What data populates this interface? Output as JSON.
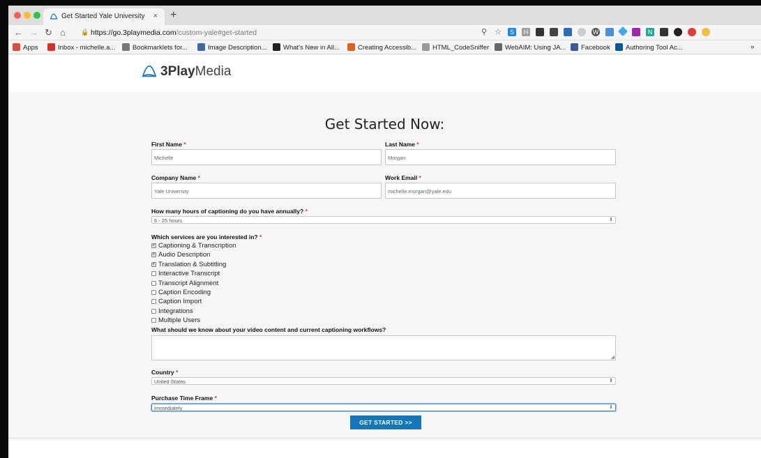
{
  "browser": {
    "tab_title": "Get Started Yale University",
    "tab_close": "×",
    "new_tab": "+",
    "url_host": "https://go.3playmedia.com",
    "url_path": "/custom-yale#get-started",
    "bookmarks": [
      {
        "label": "Apps",
        "icon": "apps-grid-icon",
        "color": "#e24b3b"
      },
      {
        "label": "Inbox - michelle.a...",
        "icon": "gmail-icon",
        "color": "#d93025"
      },
      {
        "label": "Bookmarklets for...",
        "icon": "folder-icon",
        "color": "#777777"
      },
      {
        "label": "Image Description...",
        "icon": "image-icon",
        "color": "#3b6aa8"
      },
      {
        "label": "What's New in All...",
        "icon": "bb-icon",
        "color": "#222222"
      },
      {
        "label": "Creating Accessib...",
        "icon": "accessibility-icon",
        "color": "#e0621c"
      },
      {
        "label": "HTML_CodeSniffer",
        "icon": "page-icon",
        "color": "#999999"
      },
      {
        "label": "WebAIM: Using JA...",
        "icon": "webaim-icon",
        "color": "#666666"
      },
      {
        "label": "Facebook",
        "icon": "facebook-icon",
        "color": "#3b5998"
      },
      {
        "label": "Authoring Tool Ac...",
        "icon": "w3c-icon",
        "color": "#005a9c"
      }
    ],
    "more_bookmarks": "»"
  },
  "site": {
    "brand_bold": "3Play",
    "brand_light": "Media",
    "brand_color": "#1377b9"
  },
  "form": {
    "title": "Get Started Now:",
    "required_mark": "*",
    "first_name": {
      "label": "First Name",
      "value": "Michelle"
    },
    "last_name": {
      "label": "Last Name",
      "value": "Morgan"
    },
    "company": {
      "label": "Company Name",
      "value": "Yale University"
    },
    "email": {
      "label": "Work Email",
      "value": "michelle.morgan@yale.edu"
    },
    "hours": {
      "label": "How many hours of captioning do you have annually?",
      "value": "6 - 25 hours"
    },
    "services": {
      "label": "Which services are you interested in?",
      "options": [
        {
          "label": "Captioning & Transcription",
          "checked": true
        },
        {
          "label": "Audio Description",
          "checked": true
        },
        {
          "label": "Translation & Subtitling",
          "checked": true
        },
        {
          "label": "Interactive Transcript",
          "checked": false
        },
        {
          "label": "Transcript Alignment",
          "checked": false
        },
        {
          "label": "Caption Encoding",
          "checked": false
        },
        {
          "label": "Caption Import",
          "checked": false
        },
        {
          "label": "Integrations",
          "checked": false
        },
        {
          "label": "Multiple Users",
          "checked": false
        }
      ]
    },
    "workflow": {
      "label": "What should we know about your video content and current captioning workflows?",
      "value": ""
    },
    "country": {
      "label": "Country",
      "value": "United States"
    },
    "timeframe": {
      "label": "Purchase Time Frame",
      "value": "Immediately"
    },
    "submit_label": "GET STARTED >>"
  }
}
